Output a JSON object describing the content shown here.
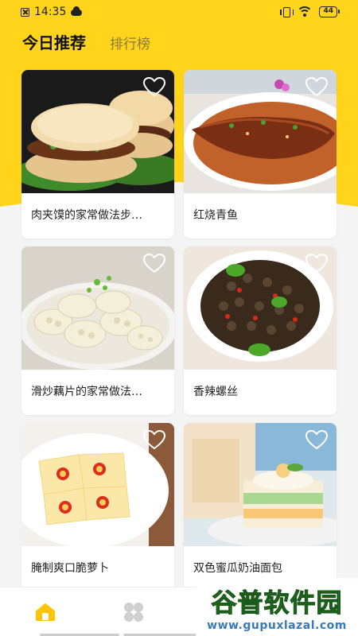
{
  "status_bar": {
    "time": "14:35",
    "battery": "44"
  },
  "tabs": {
    "active": "今日推荐",
    "inactive": "排行榜"
  },
  "recipes": [
    {
      "title": "肉夹馍的家常做法步…",
      "image": "roujiamo"
    },
    {
      "title": "红烧青鱼",
      "image": "braised-fish"
    },
    {
      "title": "滑炒藕片的家常做法…",
      "image": "lotus-root"
    },
    {
      "title": "香辣螺丝",
      "image": "spicy-snails"
    },
    {
      "title": "腌制爽口脆萝卜",
      "image": "pickled-radish"
    },
    {
      "title": "双色蜜瓜奶油面包",
      "image": "melon-cream-bread"
    }
  ],
  "bottom_nav": {
    "items": [
      "home-icon",
      "grid-icon"
    ],
    "active_color": "#ffc400"
  },
  "watermark": {
    "main": "谷普软件园",
    "url": "www.gupuxlazal.com"
  },
  "colors": {
    "brand_yellow": "#ffd41a"
  }
}
